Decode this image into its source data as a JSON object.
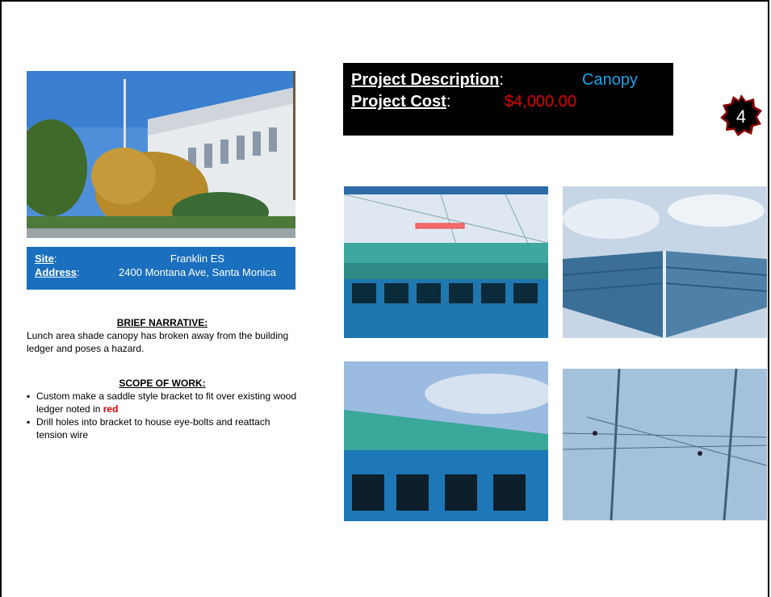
{
  "project": {
    "description_label": "Project Description",
    "description_value": "Canopy",
    "cost_label": "Project Cost",
    "cost_value": "$4,000.00",
    "number": "4"
  },
  "site": {
    "site_label": "Site",
    "site_value": "Franklin ES",
    "address_label": "Address",
    "address_value": "2400 Montana Ave, Santa Monica"
  },
  "narrative": {
    "heading": "BRIEF NARRATIVE:",
    "text": "Lunch area shade canopy has broken away  from the building ledger and poses a hazard."
  },
  "scope": {
    "heading": "SCOPE OF WORK:",
    "item1_text": "Custom make a saddle style bracket to fit over existing wood ledger noted in ",
    "item1_emphasis": "red",
    "item2_text": "Drill holes into bracket to house eye-bolts and reattach tension wire"
  },
  "colors": {
    "site_box": "#1a6fbf",
    "description_value": "#1aa3e8",
    "cost_value": "#e00000",
    "badge": "#8b0000"
  },
  "images": [
    "school-building-photo",
    "canopy-ledger-photo",
    "canopy-underside-photo",
    "building-wall-photo",
    "canopy-wires-photo"
  ]
}
